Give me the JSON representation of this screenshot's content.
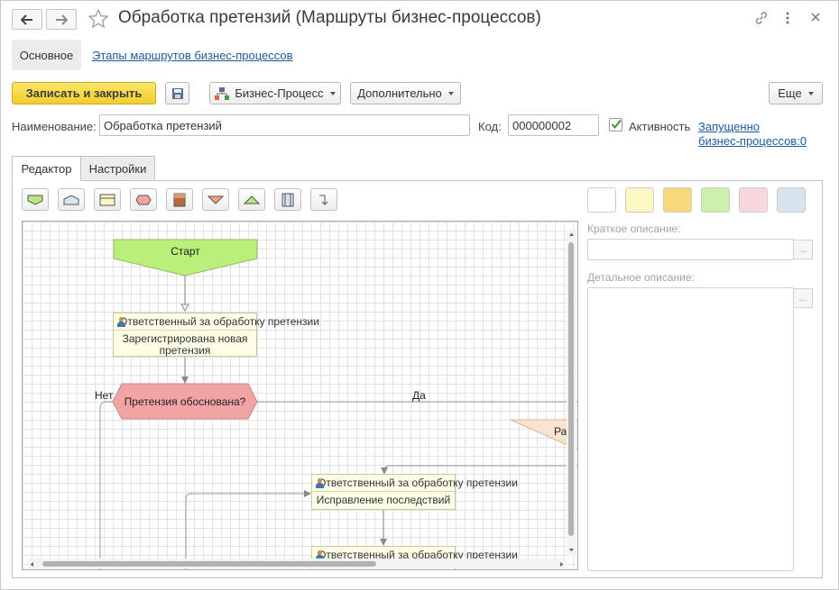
{
  "window": {
    "title": "Обработка претензий (Маршруты бизнес-процессов)"
  },
  "nav": {
    "main_tab": "Основное",
    "stages_link": "Этапы маршрутов бизнес-процессов"
  },
  "toolbar": {
    "save_close": "Записать и закрыть",
    "business_process": "Бизнес-Процесс",
    "additional": "Дополнительно",
    "more": "Еще"
  },
  "form": {
    "name_label": "Наименование:",
    "name_value": "Обработка претензий",
    "code_label": "Код:",
    "code_value": "000000002",
    "active_label": "Активность",
    "active_checked": true,
    "running_link_line1": "Запущенно",
    "running_link_line2": "бизнес-процессов:0"
  },
  "tabs": {
    "editor": "Редактор",
    "settings": "Настройки"
  },
  "palette": {
    "shapes": [
      "start-shape-icon",
      "point-shape-icon",
      "action-shape-icon",
      "activity-shape-icon",
      "processing-shape-icon",
      "end-shape-icon",
      "up-shape-icon",
      "subprocess-shape-icon",
      "connector-icon"
    ],
    "colors": [
      "#ffffff",
      "#fdf7c4",
      "#f8d979",
      "#cdf0ad",
      "#f7d8dc",
      "#d7e4f0"
    ]
  },
  "diagram": {
    "start_label": "Старт",
    "task1_header": "Ответственный за обработку претензии",
    "task1_body": "Зарегистрирована новая претензия",
    "decision_label": "Претензия обоснована?",
    "no_label": "Нет",
    "yes_label": "Да",
    "cut_label": "Ра",
    "task2_header": "Ответственный за обработку претензии",
    "task2_body": "Исправление последствий",
    "task3_header": "Ответственный за обработку претензии"
  },
  "details": {
    "short_desc_label": "Краткое описание:",
    "detail_desc_label": "Детальное описание:",
    "dots": "..."
  }
}
